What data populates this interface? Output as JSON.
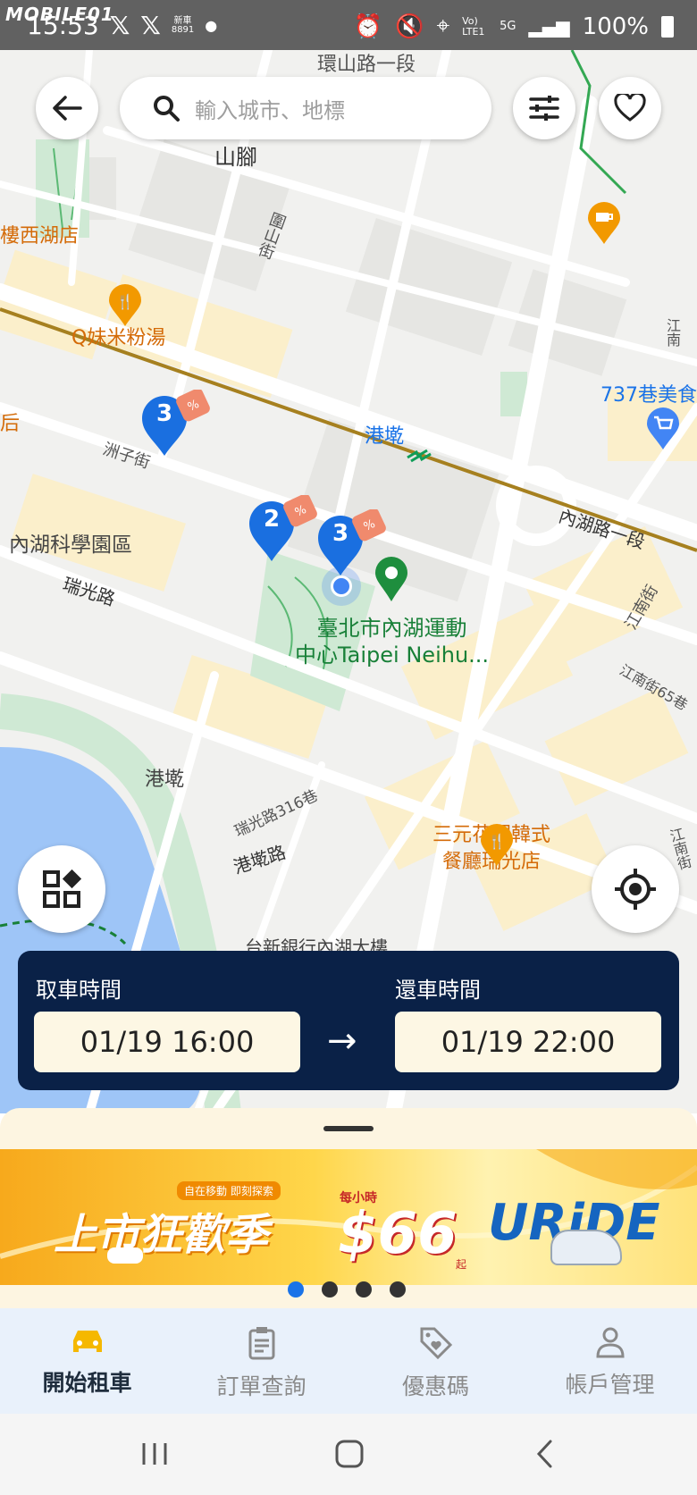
{
  "status_bar": {
    "watermark": "MOBILE01",
    "time": "15:53",
    "left_icons": [
      "x-icon",
      "x-icon",
      "news-icon",
      "dot-icon"
    ],
    "news_text": "新車\n8891",
    "network": "Vo) LTE1",
    "network_type": "5G",
    "battery": "100%"
  },
  "top_bar": {
    "search_placeholder": "輸入城市、地標"
  },
  "map": {
    "labels": {
      "street_top": "環山路一段",
      "shanjiao": "山腳",
      "lanshan": "圍山街",
      "lou_xihu": "樓西湖店",
      "q_mei": "Q妹米粉湯",
      "shop737": "737巷美食",
      "gangqian_station": "港墘",
      "zhouzi": "洲子街",
      "neihu_tech": "內湖科學園區",
      "ruiguang": "瑞光路",
      "neihu_road": "內湖路一段",
      "jiangnan": "江南街",
      "jiangnan65": "江南街65巷",
      "sports_center_1": "臺北市內湖運動",
      "sports_center_2": "中心Taipei Neihu...",
      "gangqian": "港墘",
      "ruiguang316": "瑞光路316巷",
      "gangqian_road": "港墘路",
      "sanyuan_1": "三元花園韓式",
      "sanyuan_2": "餐廳瑞光店",
      "bank": "台新銀行內湖大樓",
      "left_edge": "后",
      "right_edge_top": "江南",
      "jiangnan_right": "江南街"
    },
    "clusters": [
      {
        "count": "3"
      },
      {
        "count": "2"
      },
      {
        "count": "3"
      }
    ]
  },
  "time_card": {
    "pickup_label": "取車時間",
    "pickup_value": "01/19 16:00",
    "return_label": "還車時間",
    "return_value": "01/19 22:00",
    "arrow": "→"
  },
  "banner": {
    "headline": "上市狂歡季",
    "tagline": "自在移動 即刻探索",
    "price_prefix": "每小時",
    "price": "$66",
    "price_suffix": "起",
    "brand": "URiDE",
    "page_count": 4,
    "active_page": 1
  },
  "tabs": [
    {
      "label": "開始租車",
      "icon": "car-icon",
      "active": true
    },
    {
      "label": "訂單查詢",
      "icon": "clipboard-icon",
      "active": false
    },
    {
      "label": "優惠碼",
      "icon": "tag-icon",
      "active": false
    },
    {
      "label": "帳戶管理",
      "icon": "person-icon",
      "active": false
    }
  ],
  "colors": {
    "accent_blue": "#1a73e8",
    "card_navy": "#0a2147",
    "active_tab_icon": "#f5b800",
    "banner_yellow": "#ffd64a"
  }
}
